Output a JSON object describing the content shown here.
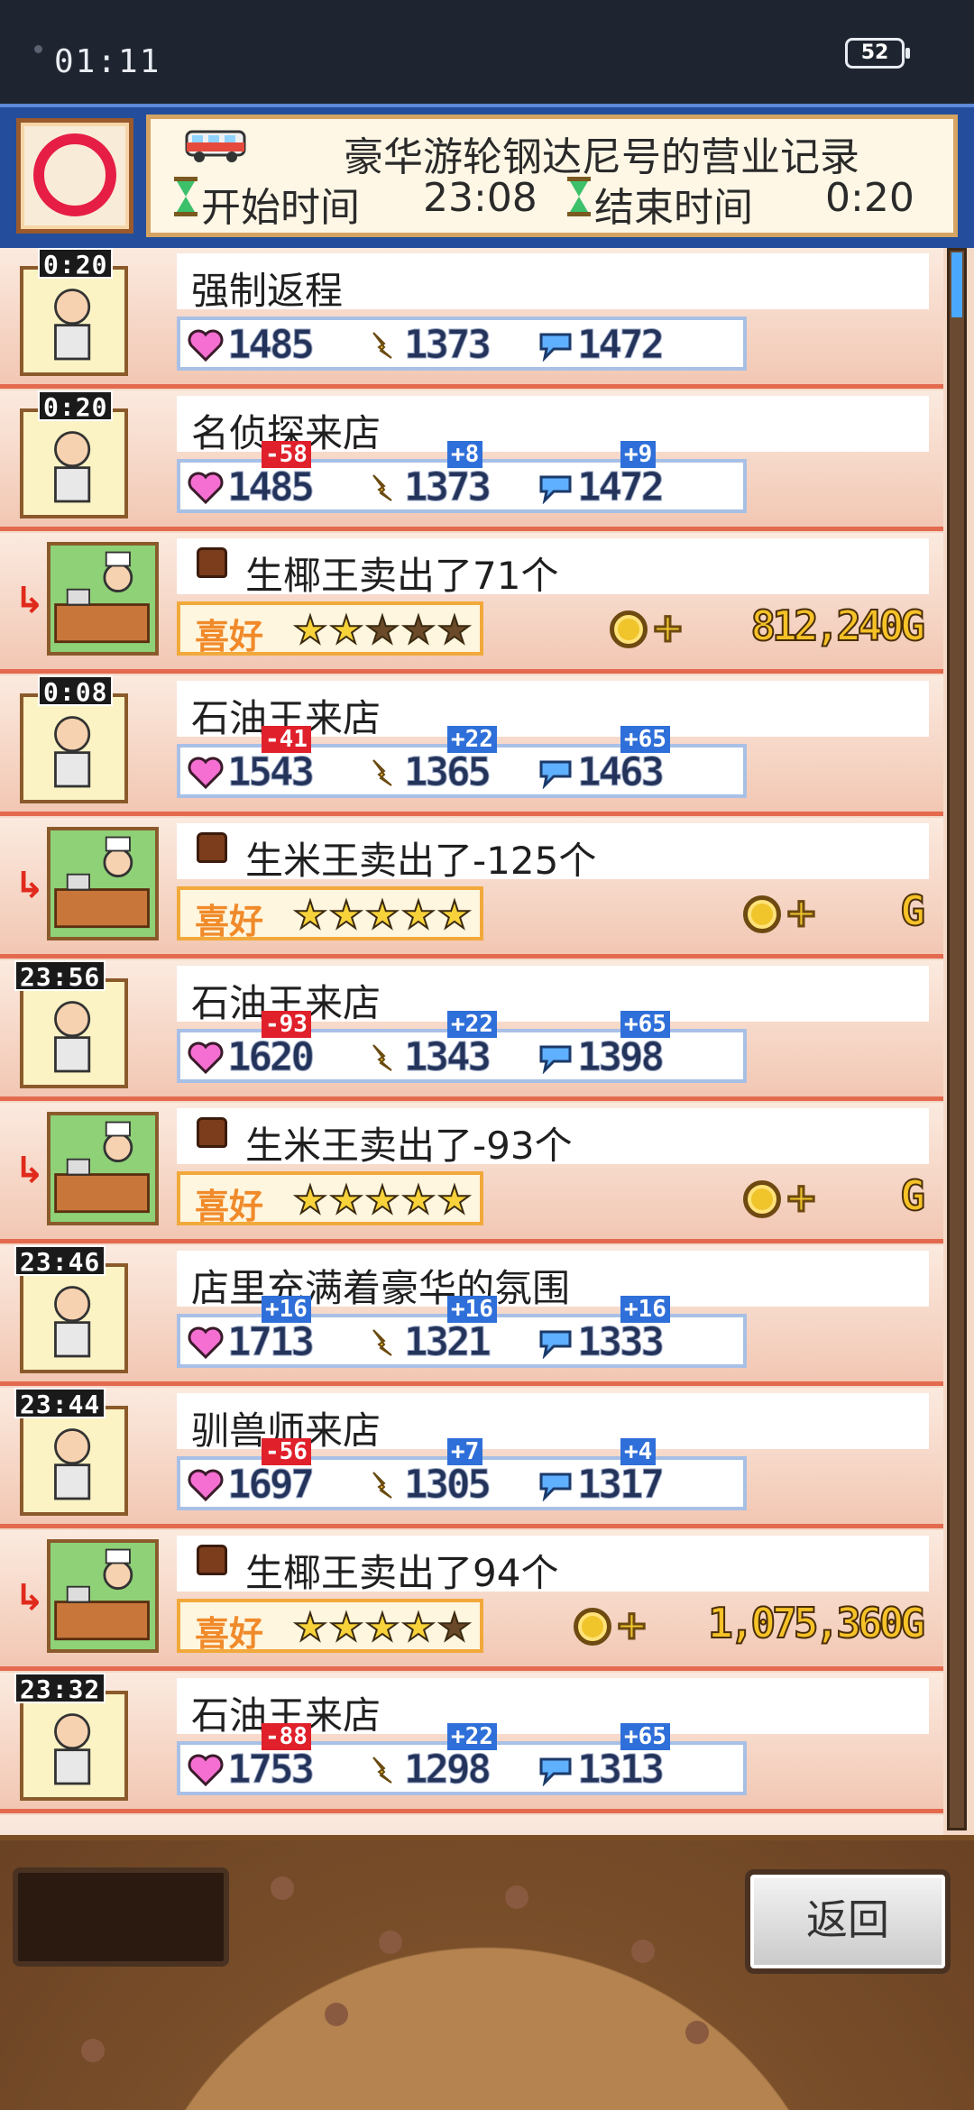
{
  "status_bar": {
    "time": "01:11",
    "battery": "52"
  },
  "header": {
    "title": "豪华游轮钢达尼号的营业记录",
    "start_label": "开始时间",
    "start_time": "23:08",
    "end_label": "结束时间",
    "end_time": "0:20"
  },
  "entries": [
    {
      "kind": "event",
      "time": "0:20",
      "text": "强制返程",
      "stats": [
        "1485",
        "1373",
        "1472"
      ],
      "deltas": [
        "",
        "",
        ""
      ]
    },
    {
      "kind": "event",
      "time": "0:20",
      "text": "名侦探来店",
      "stats": [
        "1485",
        "1373",
        "1472"
      ],
      "deltas": [
        "-58",
        "+8",
        "+9"
      ]
    },
    {
      "kind": "sale",
      "text": "生椰王卖出了71个",
      "like_label": "喜好",
      "stars": 2,
      "gold": "812,240G"
    },
    {
      "kind": "event",
      "time": "0:08",
      "text": "石油王来店",
      "stats": [
        "1543",
        "1365",
        "1463"
      ],
      "deltas": [
        "-41",
        "+22",
        "+65"
      ]
    },
    {
      "kind": "sale",
      "text": "生米王卖出了-125个",
      "like_label": "喜好",
      "stars": 5,
      "gold": "G"
    },
    {
      "kind": "event",
      "time": "23:56",
      "text": "石油王来店",
      "stats": [
        "1620",
        "1343",
        "1398"
      ],
      "deltas": [
        "-93",
        "+22",
        "+65"
      ]
    },
    {
      "kind": "sale",
      "text": "生米王卖出了-93个",
      "like_label": "喜好",
      "stars": 5,
      "gold": "G"
    },
    {
      "kind": "event",
      "time": "23:46",
      "text": "店里充满着豪华的氛围",
      "stats": [
        "1713",
        "1321",
        "1333"
      ],
      "deltas": [
        "+16",
        "+16",
        "+16"
      ]
    },
    {
      "kind": "event",
      "time": "23:44",
      "text": "驯兽师来店",
      "stats": [
        "1697",
        "1305",
        "1317"
      ],
      "deltas": [
        "-56",
        "+7",
        "+4"
      ]
    },
    {
      "kind": "sale",
      "text": "生椰王卖出了94个",
      "like_label": "喜好",
      "stars": 4,
      "gold": "1,075,360G"
    },
    {
      "kind": "event",
      "time": "23:32",
      "text": "石油王来店",
      "stats": [
        "1753",
        "1298",
        "1313"
      ],
      "deltas": [
        "-88",
        "+22",
        "+65"
      ]
    }
  ],
  "footer": {
    "back_label": "返回"
  },
  "colors": {
    "header_blue": "#244e9c",
    "row_border": "#e36a4e",
    "gold": "#f6c227"
  }
}
